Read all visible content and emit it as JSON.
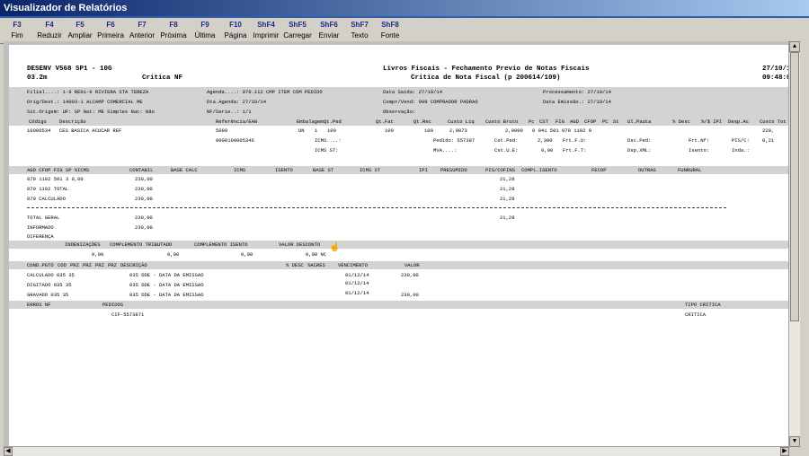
{
  "window": {
    "title": "Visualizador de Relatórios"
  },
  "toolbar": [
    {
      "key": "F3",
      "label": "Fim"
    },
    {
      "key": "F4",
      "label": "Reduzir"
    },
    {
      "key": "F5",
      "label": "Ampliar"
    },
    {
      "key": "F6",
      "label": "Primeira"
    },
    {
      "key": "F7",
      "label": "Anterior"
    },
    {
      "key": "F8",
      "label": "Próxima"
    },
    {
      "key": "F9",
      "label": "Última"
    },
    {
      "key": "F10",
      "label": "Página"
    },
    {
      "key": "ShF4",
      "label": "Imprimir"
    },
    {
      "key": "ShF5",
      "label": "Carregar"
    },
    {
      "key": "ShF6",
      "label": "Enviar"
    },
    {
      "key": "ShF7",
      "label": "Texto"
    },
    {
      "key": "ShF8",
      "label": "Fonte"
    }
  ],
  "report": {
    "header": {
      "system": "DESENV V568 SP1 - 10G",
      "version": "03.2m",
      "subtitle_left": "Critica NF",
      "title": "Livros Fiscais - Fechamento Previo de Notas Fiscais",
      "subtitle": "Critica de Nota Fiscal (p 200614/109)",
      "date": "27/10/1",
      "time": "09:48:0"
    },
    "info": {
      "filial": "Filial....:    1-9 RE01-9 RIVIERA STA TEREZA",
      "agenda": "Agenda....: 079.112  CMP ITEM COM PEDIDO",
      "data_saida": "Data Saida: 27/10/14",
      "processamento": "Processamento: 27/10/14",
      "orig": "Orig/Dest.:   14003-1 ALCAMP COMERCIAL ME",
      "dta_agenda": "Dta.Agenda: 27/10/14",
      "compr": "Compr/Vend: 999 COMPRADOR PADRAO",
      "data_emissao": "Data Emissão.: 27/10/14",
      "sit_origem": "Sit.Origem: UF: SP  Nat: ME  Simples Nac: Não",
      "nf_serie": "NF/Serie..: 1/1",
      "observacao": "Observação:"
    },
    "item_header": [
      "Código",
      "Descrição",
      "Referência/EAN",
      "Embalagem",
      "Qt.Ped",
      "Qt.Fat",
      "Qt.Rec",
      "Custo Liq",
      "Custo Bruto",
      "Pc",
      "CST",
      "FIG",
      "AGD",
      "CFOP",
      "PC",
      "St",
      "Ul.Pauta",
      "% Desc",
      "%/$ IPI",
      "Desp.Ac",
      "Custo Tot"
    ],
    "item": {
      "codigo": "10000534",
      "descricao": "CES BASICA ACUCAR REF",
      "referencia": "5080",
      "embalagem": "UN",
      "emb_qtd": "1",
      "qt_ped": "100",
      "qt_fat": "100",
      "qt_rec": "100",
      "custo_liq": "2,0873",
      "custo_bruto": "2,0000",
      "cst_etc": "0 041 501 079  1102  0",
      "custo_tot": "220,",
      "ean": "0000100005346"
    },
    "item_extra": {
      "icms": "ICMS....:",
      "icms_st": "ICMS ST:",
      "pedido": "Pedido:    557387",
      "cst_ped": "Cst.Ped:",
      "cst_ped_val": "2,300",
      "frt_fu": "Frt.F.U:",
      "dsc_ped": "Dsc.Ped:",
      "frt_nf": "Frt.Nf:",
      "pis_c": "PIS/C:",
      "pis_c_val": "0,21",
      "mva": "MVA....:",
      "cst_ue": "Cst.U.E:",
      "cst_ue_val": "0,00",
      "frt_ft": "Frt.F.T:",
      "dsp_xml": "Dsp.XML:",
      "isento": "Isento:",
      "inda": "Inda.:"
    },
    "fiscal_header": [
      "AGD CFOP FIG SP  %ICMS",
      "CONTABIL",
      "BASE CALC",
      "ICMS",
      "ISENTO",
      "BASE ST",
      "ICMS ST",
      "IPI",
      "PRESUMIDO",
      "PIS/COFINS",
      "COMPL.ISENTO",
      "FECOP",
      "OUTRAS",
      "FUNRURAL"
    ],
    "fiscal_rows": [
      {
        "label": "079 1102 501  3   0,00",
        "contabil": "230,00",
        "pis": "21,28"
      },
      {
        "label": "079 1102 TOTAL",
        "contabil": "230,00",
        "pis": "21,28"
      },
      {
        "label": "079 CALCULADO",
        "contabil": "230,00",
        "pis": "21,28"
      }
    ],
    "totals": [
      {
        "label": "TOTAL GERAL",
        "contabil": "230,00",
        "pis": "21,28"
      },
      {
        "label": "INFORMADO",
        "contabil": "230,00",
        "pis": ""
      },
      {
        "label": "DIFERENÇA",
        "contabil": "",
        "pis": ""
      }
    ],
    "indeniz_header": [
      "INDENIZAÇÕES",
      "COMPLEMENTO TRIBUTADO",
      "COMPLEMENTO ISENTO",
      "VALOR DESCONTO"
    ],
    "indeniz_values": [
      "0,00",
      "0,00",
      "0,00",
      "0,00 NC"
    ],
    "cond_header": [
      "COND.PGTO",
      "COD",
      "PRZ",
      "PRZ",
      "PRZ",
      "PRZ",
      "DESCRIÇÃO",
      "% DESC",
      "%ACRES",
      "VENCIMENTO",
      "VALOR"
    ],
    "cond_rows": [
      {
        "label": "CALCULADO 035  35",
        "descricao": "035 DDE - DATA DA EMISSAO",
        "vencimento": "01/12/14",
        "valor": "230,00"
      },
      {
        "label": "DIGITADO  035  35",
        "descricao": "035 DDE - DATA DA EMISSAO",
        "vencimento": "01/12/14",
        "valor": ""
      },
      {
        "label": "GRAVADO   035  35",
        "descricao": "035 DDE - DATA DA EMISSAO",
        "vencimento": "01/12/14",
        "valor": "230,00"
      }
    ],
    "errors_header": [
      "ERROS NF",
      "PEDIDOS",
      "TIPO CRITICA"
    ],
    "errors_row": {
      "pedido": "CIF-5573871",
      "tipo": "CRITICA"
    }
  }
}
